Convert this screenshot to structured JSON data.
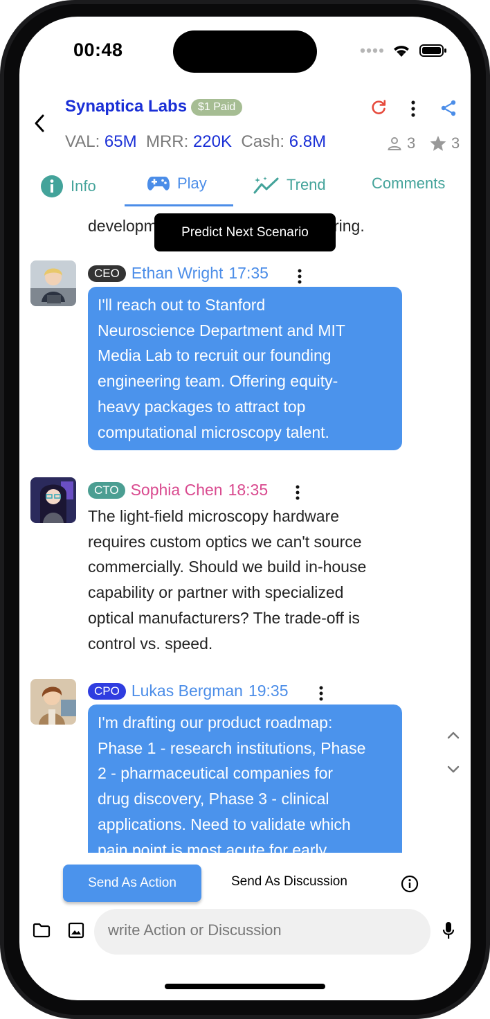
{
  "status_bar": {
    "time": "00:48"
  },
  "header": {
    "company_name": "Synaptica Labs",
    "paid_badge": "$1 Paid",
    "metrics": {
      "val_label": "VAL:",
      "val": "65M",
      "mrr_label": "MRR:",
      "mrr": "220K",
      "cash_label": "Cash:",
      "cash": "6.8M"
    },
    "members_count": "3",
    "stars_count": "3"
  },
  "tabs": [
    {
      "label": "Info",
      "icon": "info-icon"
    },
    {
      "label": "Play",
      "icon": "gamepad-icon",
      "active": true
    },
    {
      "label": "Trend",
      "icon": "trend-icon"
    },
    {
      "label": "Comments"
    }
  ],
  "tooltip": "Predict Next Scenario",
  "partial_text": {
    "line1_left": "developm",
    "line1_right": "ring."
  },
  "messages": [
    {
      "role": "CEO",
      "author": "Ethan Wright",
      "time": "17:35",
      "role_color": "#333333",
      "name_color": "#4b8de8",
      "style": "bubble",
      "lines": [
        "I'll reach out to Stanford",
        "Neuroscience Department and MIT",
        "Media Lab to recruit our founding",
        "engineering team. Offering equity-",
        "heavy packages to attract top",
        "computational microscopy talent."
      ]
    },
    {
      "role": "CTO",
      "author": "Sophia Chen",
      "time": "18:35",
      "role_color": "#4b9e92",
      "name_color": "#d94a8f",
      "style": "plain",
      "lines": [
        "The light-field microscopy hardware",
        "requires custom optics we can't source",
        "commercially. Should we build in-house",
        "capability or partner with specialized",
        "optical manufacturers? The trade-off is",
        "control vs. speed."
      ]
    },
    {
      "role": "CPO",
      "author": "Lukas Bergman",
      "time": "19:35",
      "role_color": "#2f3de0",
      "name_color": "#4b8de8",
      "style": "bubble",
      "lines": [
        "I'm drafting our product roadmap:",
        "Phase 1 - research institutions, Phase",
        "2 - pharmaceutical companies for",
        "drug discovery, Phase 3 - clinical",
        "applications. Need to validate which",
        "pain point is most acute for early"
      ]
    }
  ],
  "composer": {
    "send_action": "Send As Action",
    "send_discussion": "Send As Discussion",
    "placeholder": "write Action or Discussion"
  },
  "colors": {
    "accent_blue": "#4b93ec",
    "brand_navy": "#1a2fd6",
    "teal": "#43a39a",
    "refresh_red": "#e64a3c"
  }
}
